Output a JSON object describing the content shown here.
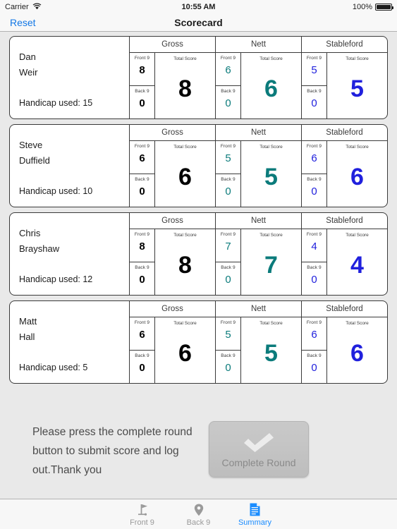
{
  "status_bar": {
    "carrier": "Carrier",
    "wifi_icon": "wifi-icon",
    "time": "10:55 AM",
    "battery_percent": "100%",
    "battery_icon": "battery-full-icon"
  },
  "nav_bar": {
    "reset_label": "Reset",
    "title": "Scorecard"
  },
  "colors": {
    "accent_blue": "#1277e6",
    "gross": "#000000",
    "nett": "#0b7b7b",
    "stableford": "#2020dd",
    "tab_selected": "#1a8cff",
    "tab_unselected": "#9a9a9a"
  },
  "column_headers": {
    "gross": "Gross",
    "nett": "Nett",
    "stableford": "Stableford",
    "front": "Front 9",
    "back": "Back 9",
    "total": "Total Score"
  },
  "players": [
    {
      "first_name": "Dan",
      "last_name": "Weir",
      "handicap_label": "Handicap used: 15",
      "gross": {
        "front": "8",
        "back": "0",
        "total": "8"
      },
      "nett": {
        "front": "6",
        "back": "0",
        "total": "6"
      },
      "stableford": {
        "front": "5",
        "back": "0",
        "total": "5"
      }
    },
    {
      "first_name": "Steve",
      "last_name": "Duffield",
      "handicap_label": "Handicap used: 10",
      "gross": {
        "front": "6",
        "back": "0",
        "total": "6"
      },
      "nett": {
        "front": "5",
        "back": "0",
        "total": "5"
      },
      "stableford": {
        "front": "6",
        "back": "0",
        "total": "6"
      }
    },
    {
      "first_name": "Chris",
      "last_name": "Brayshaw",
      "handicap_label": "Handicap used: 12",
      "gross": {
        "front": "8",
        "back": "0",
        "total": "8"
      },
      "nett": {
        "front": "7",
        "back": "0",
        "total": "7"
      },
      "stableford": {
        "front": "4",
        "back": "0",
        "total": "4"
      }
    },
    {
      "first_name": "Matt",
      "last_name": "Hall",
      "handicap_label": "Handicap used: 5",
      "gross": {
        "front": "6",
        "back": "0",
        "total": "6"
      },
      "nett": {
        "front": "5",
        "back": "0",
        "total": "5"
      },
      "stableford": {
        "front": "6",
        "back": "0",
        "total": "6"
      }
    }
  ],
  "footer": {
    "prompt": "Please press the complete round button to submit score and log out.Thank you",
    "complete_button_label": "Complete Round",
    "complete_button_icon": "checkmark-icon"
  },
  "tab_bar": {
    "tabs": [
      {
        "label": "Front 9",
        "icon": "golf-flag-icon",
        "selected": false
      },
      {
        "label": "Back 9",
        "icon": "map-pin-icon",
        "selected": false
      },
      {
        "label": "Summary",
        "icon": "document-icon",
        "selected": true
      }
    ]
  }
}
